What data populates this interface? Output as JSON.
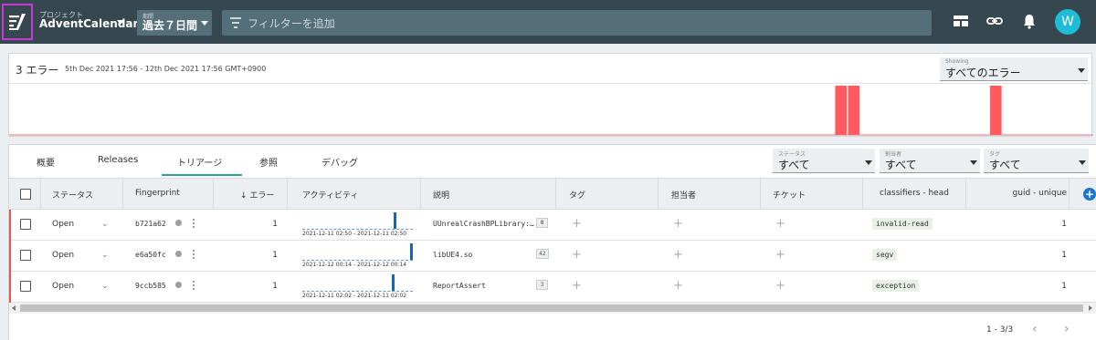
{
  "topbar": {
    "project_small": "プロジェクト",
    "project_name": "AdventCalendar",
    "range_small": "期間",
    "range_label": "過去７日間",
    "filter_placeholder": "フィルターを追加",
    "avatar_letter": "W",
    "icons": [
      "logo-icon",
      "layout-icon",
      "link-icon",
      "bell-icon"
    ]
  },
  "summary": {
    "error_count": "3 エラー",
    "date_range": "5th Dec 2021 17:56 - 12th Dec 2021 17:56 GMT+0900",
    "showing_small": "Showing",
    "showing_value": "すべてのエラー",
    "histogram": {
      "buckets": 84,
      "bar_buckets": [
        64,
        65,
        76
      ],
      "bar_color": "#ff5a5f"
    }
  },
  "tabs": [
    {
      "label": "概要"
    },
    {
      "label": "Releases"
    },
    {
      "label": "トリアージ",
      "active": true
    },
    {
      "label": "参照"
    },
    {
      "label": "デバッグ"
    }
  ],
  "selects": [
    {
      "small": "ステータス",
      "value": "すべて"
    },
    {
      "small": "割当者",
      "value": "すべて"
    },
    {
      "small": "タグ",
      "value": "すべて"
    }
  ],
  "table": {
    "headers": {
      "status": "ステータス",
      "fingerprint": "Fingerprint",
      "errors": "↓ エラー",
      "activity": "アクティビティ",
      "description": "説明",
      "tags": "タグ",
      "assignee": "担当者",
      "ticket": "チケット",
      "classifiers": "classifiers - head",
      "guid": "guid - unique"
    },
    "rows": [
      {
        "status": "Open",
        "fingerprint": "b721a62",
        "errors": "1",
        "activity_range": "2021-12-11 02:50  -  2021-12-11 02:50",
        "spark_position": 0.85,
        "description": "UUnrealCrashBPLibrary:…",
        "desc_count": "8",
        "classifier": "invalid-read",
        "guid": "1"
      },
      {
        "status": "Open",
        "fingerprint": "e6a50fc",
        "errors": "1",
        "activity_range": "2021-12-12 00:14  -  2021-12-12 00:14",
        "spark_position": 1.0,
        "description": "libUE4.so",
        "desc_count": "42",
        "classifier": "segv",
        "guid": "1"
      },
      {
        "status": "Open",
        "fingerprint": "9ccb585",
        "errors": "1",
        "activity_range": "2021-12-11 02:02  -  2021-12-11 02:02",
        "spark_position": 0.83,
        "description": "ReportAssert",
        "desc_count": "3",
        "classifier": "exception",
        "guid": "1"
      }
    ]
  },
  "pager": {
    "label": "1 - 3/3",
    "prev": "‹",
    "next": "›"
  }
}
